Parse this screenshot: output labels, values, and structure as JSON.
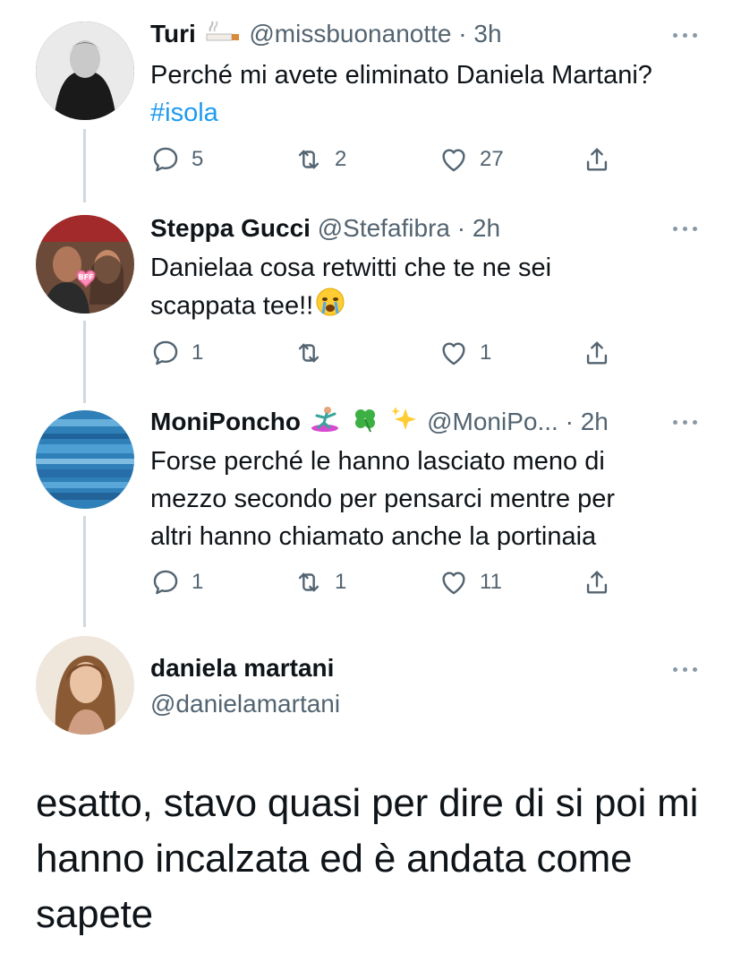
{
  "tweets": [
    {
      "name": "Turi",
      "handle": "@missbuonanotte",
      "time": "· 3h",
      "text": "Perché mi avete eliminato Daniela Martani?",
      "hashtag": "#isola",
      "replies": "5",
      "retweets": "2",
      "likes": "27"
    },
    {
      "name": "Steppa Gucci",
      "handle": "@Stefafibra",
      "time": "· 2h",
      "text_line1": "Danielaa cosa retwitti che te ne sei",
      "text_line2": "scappata tee!!",
      "replies": "1",
      "retweets": "",
      "likes": "1"
    },
    {
      "name": "MoniPoncho",
      "handle": "@MoniPo...",
      "time": "· 2h",
      "text_line1": "Forse perché le hanno lasciato meno di",
      "text_line2": "mezzo secondo per pensarci mentre per",
      "text_line3": "altri  hanno chiamato anche la portinaia",
      "replies": "1",
      "retweets": "1",
      "likes": "11"
    },
    {
      "name": "daniela martani",
      "handle": "@danielamartani",
      "text_line1": "esatto, stavo quasi per dire di si poi mi",
      "text_line2": "hanno incalzata ed è andata come",
      "text_line3": "sapete"
    }
  ],
  "icons": [
    "reply-icon",
    "retweet-icon",
    "like-icon",
    "share-icon",
    "more-icon"
  ],
  "colors": {
    "text": "#0f1419",
    "secondary": "#536471",
    "link": "#1d9bf0",
    "thread": "#cfd9de"
  }
}
